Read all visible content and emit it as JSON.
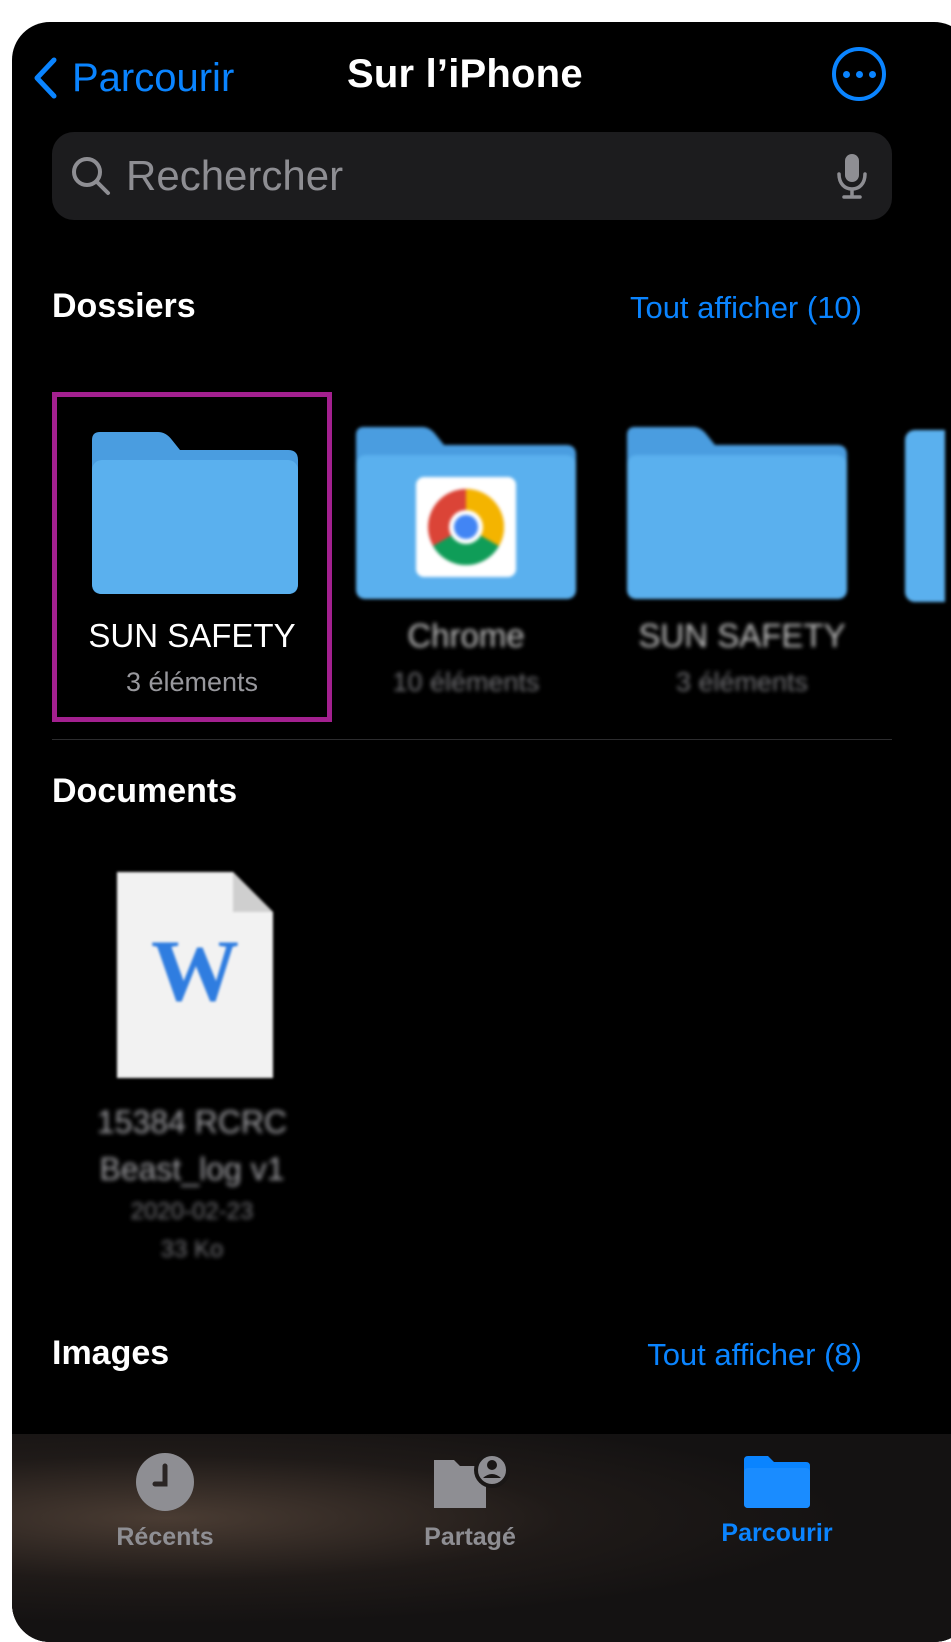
{
  "nav": {
    "back_label": "Parcourir",
    "title": "Sur l’iPhone"
  },
  "search": {
    "placeholder": "Rechercher"
  },
  "folders_section": {
    "title": "Dossiers",
    "see_all": "Tout afficher (10)",
    "items": [
      {
        "name": "SUN SAFETY",
        "count": "3 éléments"
      },
      {
        "name": "Chrome",
        "count": "10 éléments"
      },
      {
        "name": "SUN SAFETY",
        "count": "3 éléments"
      }
    ]
  },
  "documents_section": {
    "title": "Documents",
    "items": [
      {
        "name_line1": "15384 RCRC",
        "name_line2": "Beast_log v1",
        "date": "2020-02-23",
        "size": "33 Ko"
      }
    ]
  },
  "images_section": {
    "title": "Images",
    "see_all": "Tout afficher (8)"
  },
  "tabbar": {
    "tabs": [
      {
        "label": "Récents",
        "icon": "clock-icon",
        "active": false
      },
      {
        "label": "Partagé",
        "icon": "shared-folder-icon",
        "active": false
      },
      {
        "label": "Parcourir",
        "icon": "folder-icon",
        "active": true
      }
    ]
  },
  "colors": {
    "accent": "#0a84ff",
    "folder": "#5ab0ee",
    "selection": "#a3208f"
  }
}
